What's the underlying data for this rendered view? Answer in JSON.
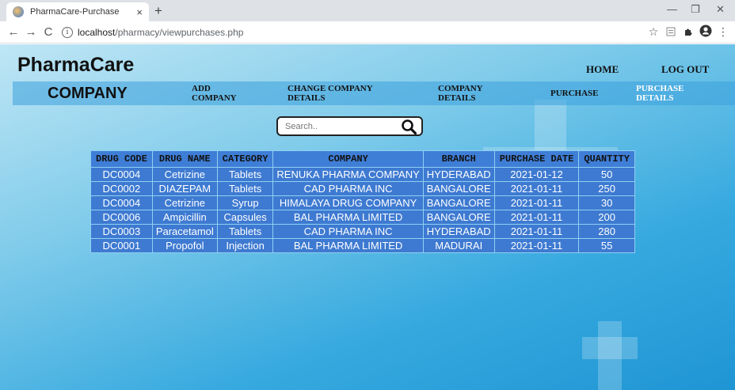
{
  "browser": {
    "tab_title": "PharmaCare-Purchase",
    "tab_close": "×",
    "new_tab": "+",
    "url_host": "localhost",
    "url_path": "/pharmacy/viewpurchases.php",
    "back": "←",
    "forward": "→",
    "reload": "C",
    "minimize": "—",
    "restore": "❐",
    "close": "✕",
    "star": "☆",
    "menu": "⋮"
  },
  "header": {
    "brand": "PharmaCare",
    "home": "HOME",
    "logout": "LOG OUT"
  },
  "menu": {
    "section": "COMPANY",
    "add_company": [
      "ADD",
      "COMPANY"
    ],
    "change_company": [
      "CHANGE COMPANY",
      "DETAILS"
    ],
    "company_details": [
      "COMPANY",
      "DETAILS"
    ],
    "purchase": "PURCHASE",
    "purchase_details": [
      "PURCHASE",
      "DETAILS"
    ]
  },
  "search": {
    "placeholder": "Search.."
  },
  "table": {
    "columns": [
      "DRUG CODE",
      "DRUG NAME",
      "CATEGORY",
      "COMPANY",
      "BRANCH",
      "PURCHASE DATE",
      "QUANTITY"
    ],
    "rows": [
      [
        "DC0004",
        "Cetrizine",
        "Tablets",
        "RENUKA PHARMA COMPANY",
        "HYDERABAD",
        "2021-01-12",
        "50"
      ],
      [
        "DC0002",
        "DIAZEPAM",
        "Tablets",
        "CAD PHARMA INC",
        "BANGALORE",
        "2021-01-11",
        "250"
      ],
      [
        "DC0004",
        "Cetrizine",
        "Syrup",
        "HIMALAYA DRUG COMPANY",
        "BANGALORE",
        "2021-01-11",
        "30"
      ],
      [
        "DC0006",
        "Ampicillin",
        "Capsules",
        "BAL PHARMA LIMITED",
        "BANGALORE",
        "2021-01-11",
        "200"
      ],
      [
        "DC0003",
        "Paracetamol",
        "Tablets",
        "CAD PHARMA INC",
        "HYDERABAD",
        "2021-01-11",
        "280"
      ],
      [
        "DC0001",
        "Propofol",
        "Injection",
        "BAL PHARMA LIMITED",
        "MADURAI",
        "2021-01-11",
        "55"
      ]
    ]
  },
  "colors": {
    "header_bg": "#3f7ed6",
    "cell_bg": "#3e7ad1",
    "grid": "#8fd0f2"
  }
}
